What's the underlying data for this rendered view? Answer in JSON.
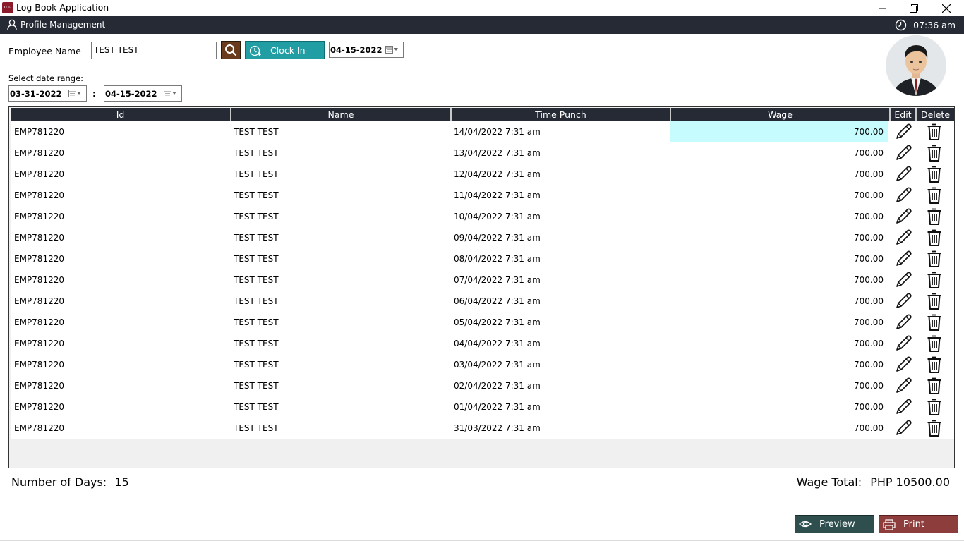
{
  "window": {
    "title": "Log Book Application",
    "icon_text": "LOG"
  },
  "header": {
    "profile_label": "Profile Management",
    "time": "07:36 am"
  },
  "form": {
    "employee_label": "Employee Name",
    "employee_value": "TEST TEST",
    "clock_in_label": "Clock In",
    "clock_date": "04-15-2022",
    "range_label": "Select date range:",
    "range_from": "03-31-2022",
    "range_separator": ":",
    "range_to": "04-15-2022"
  },
  "table": {
    "columns": [
      "Id",
      "Name",
      "Time Punch",
      "Wage",
      "Edit",
      "Delete"
    ],
    "rows": [
      {
        "id": "EMP781220",
        "name": "TEST TEST",
        "time": "14/04/2022 7:31 am",
        "wage": "700.00"
      },
      {
        "id": "EMP781220",
        "name": "TEST TEST",
        "time": "13/04/2022 7:31 am",
        "wage": "700.00"
      },
      {
        "id": "EMP781220",
        "name": "TEST TEST",
        "time": "12/04/2022 7:31 am",
        "wage": "700.00"
      },
      {
        "id": "EMP781220",
        "name": "TEST TEST",
        "time": "11/04/2022 7:31 am",
        "wage": "700.00"
      },
      {
        "id": "EMP781220",
        "name": "TEST TEST",
        "time": "10/04/2022 7:31 am",
        "wage": "700.00"
      },
      {
        "id": "EMP781220",
        "name": "TEST TEST",
        "time": "09/04/2022 7:31 am",
        "wage": "700.00"
      },
      {
        "id": "EMP781220",
        "name": "TEST TEST",
        "time": "08/04/2022 7:31 am",
        "wage": "700.00"
      },
      {
        "id": "EMP781220",
        "name": "TEST TEST",
        "time": "07/04/2022 7:31 am",
        "wage": "700.00"
      },
      {
        "id": "EMP781220",
        "name": "TEST TEST",
        "time": "06/04/2022 7:31 am",
        "wage": "700.00"
      },
      {
        "id": "EMP781220",
        "name": "TEST TEST",
        "time": "05/04/2022 7:31 am",
        "wage": "700.00"
      },
      {
        "id": "EMP781220",
        "name": "TEST TEST",
        "time": "04/04/2022 7:31 am",
        "wage": "700.00"
      },
      {
        "id": "EMP781220",
        "name": "TEST TEST",
        "time": "03/04/2022 7:31 am",
        "wage": "700.00"
      },
      {
        "id": "EMP781220",
        "name": "TEST TEST",
        "time": "02/04/2022 7:31 am",
        "wage": "700.00"
      },
      {
        "id": "EMP781220",
        "name": "TEST TEST",
        "time": "01/04/2022 7:31 am",
        "wage": "700.00"
      },
      {
        "id": "EMP781220",
        "name": "TEST TEST",
        "time": "31/03/2022 7:31 am",
        "wage": "700.00"
      }
    ]
  },
  "summary": {
    "days_label": "Number of Days:",
    "days_value": "15",
    "wage_label": "Wage Total:",
    "wage_value": "PHP 10500.00"
  },
  "footer": {
    "preview_label": "Preview",
    "print_label": "Print"
  },
  "colors": {
    "dark_bar": "#252a35",
    "clock_in": "#209ea3",
    "search": "#6a3a1c",
    "preview": "#2f4f4f",
    "print": "#8e3d3d",
    "highlight": "#c6fcfe"
  }
}
